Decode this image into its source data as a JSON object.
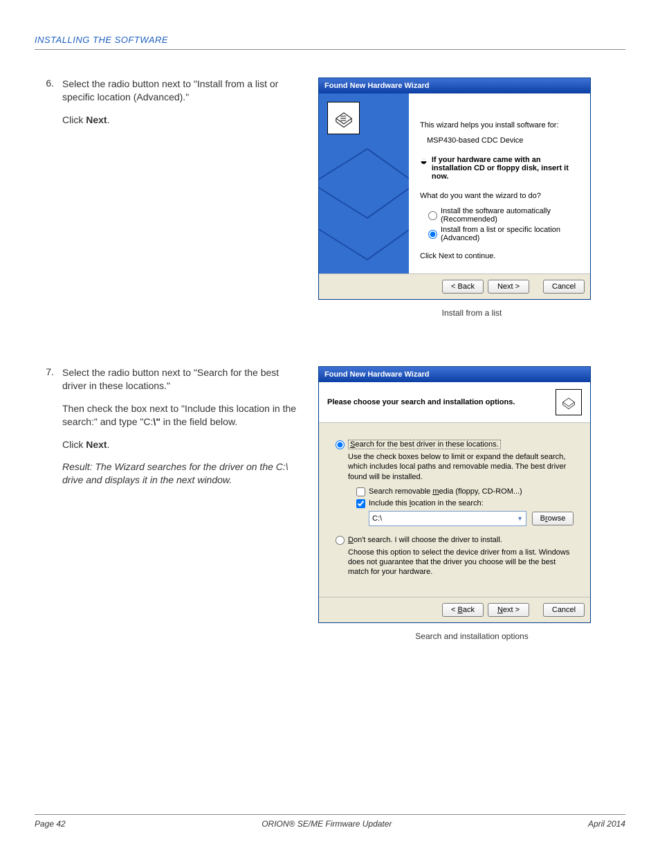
{
  "header": {
    "section": "INSTALLING THE SOFTWARE"
  },
  "step6": {
    "num": "6.",
    "p1_a": "Select the radio button next to \"Install from a list or specific location (Advanced).\"",
    "p2_a": "Click ",
    "p2_b": "Next",
    "p2_c": "."
  },
  "step7": {
    "num": "7.",
    "p1": "Select the radio button next to \"Search for the best driver in these locations.\"",
    "p2_a": "Then check the box next to \"Include this location in the search:\" and type \"C:",
    "p2_b": "\\\"",
    "p2_c": " in the field below.",
    "p3_a": "Click ",
    "p3_b": "Next",
    "p3_c": ".",
    "p4": "Result: The Wizard searches for the driver on the C:\\ drive and displays it in the next window."
  },
  "wiz1": {
    "title": "Found New Hardware Wizard",
    "l1": "This wizard helps you install software for:",
    "l2": "MSP430-based CDC Device",
    "cd": "If your hardware came with an installation CD or floppy disk, insert it now.",
    "q": "What do you want the wizard to do?",
    "r1": "Install the software automatically (Recommended)",
    "r2": "Install from a list or specific location (Advanced)",
    "cont": "Click Next to continue.",
    "back": "< Back",
    "next": "Next >",
    "cancel": "Cancel",
    "caption": "Install from a list"
  },
  "wiz2": {
    "title": "Found New Hardware Wizard",
    "head": "Please choose your search and installation options.",
    "r1_a": "S",
    "r1_b": "earch for the best driver in these locations.",
    "sub1": "Use the check boxes below to limit or expand the default search, which includes local paths and removable media. The best driver found will be installed.",
    "c1_a": "Search removable ",
    "c1_b": "m",
    "c1_c": "edia (floppy, CD-ROM...)",
    "c2_a": "Include this ",
    "c2_b": "l",
    "c2_c": "ocation in the search:",
    "path": "C:\\",
    "browse_a": "B",
    "browse_b": "r",
    "browse_c": "owse",
    "r2_a": "D",
    "r2_b": "on't search. I will choose the driver to install.",
    "sub2": "Choose this option to select the device driver from a list.  Windows does not guarantee that the driver you choose will be the best match for your hardware.",
    "back_a": "< ",
    "back_b": "B",
    "back_c": "ack",
    "next_a": "N",
    "next_b": "ext >",
    "cancel": "Cancel",
    "caption": "Search and installation options"
  },
  "footer": {
    "left": "Page 42",
    "center": "ORION® SE/ME Firmware Updater",
    "right": "April 2014"
  }
}
